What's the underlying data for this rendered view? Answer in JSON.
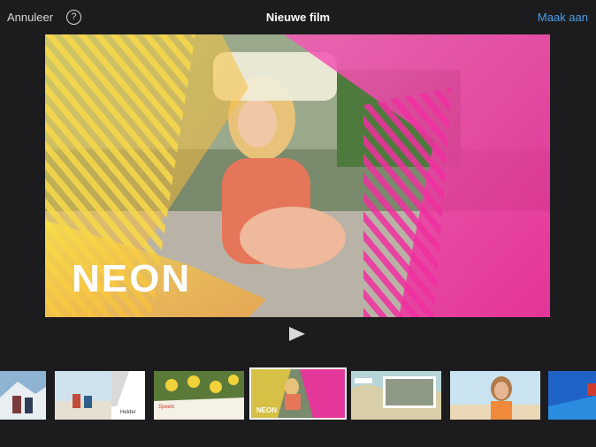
{
  "toolbar": {
    "cancel_label": "Annuleer",
    "help_label": "?",
    "title": "Nieuwe film",
    "create_label": "Maak aan"
  },
  "preview": {
    "theme_title": "NEON"
  },
  "themes": [
    {
      "label": ""
    },
    {
      "label": "Helder"
    },
    {
      "label": "Speels"
    },
    {
      "label": "NEON",
      "selected": true
    },
    {
      "label": ""
    },
    {
      "label": ""
    },
    {
      "label": ""
    }
  ],
  "colors": {
    "background": "#1c1c1e",
    "accent": "#4a9ee8",
    "neon_pink": "#f02fa0",
    "neon_yellow": "#f5d23a"
  }
}
